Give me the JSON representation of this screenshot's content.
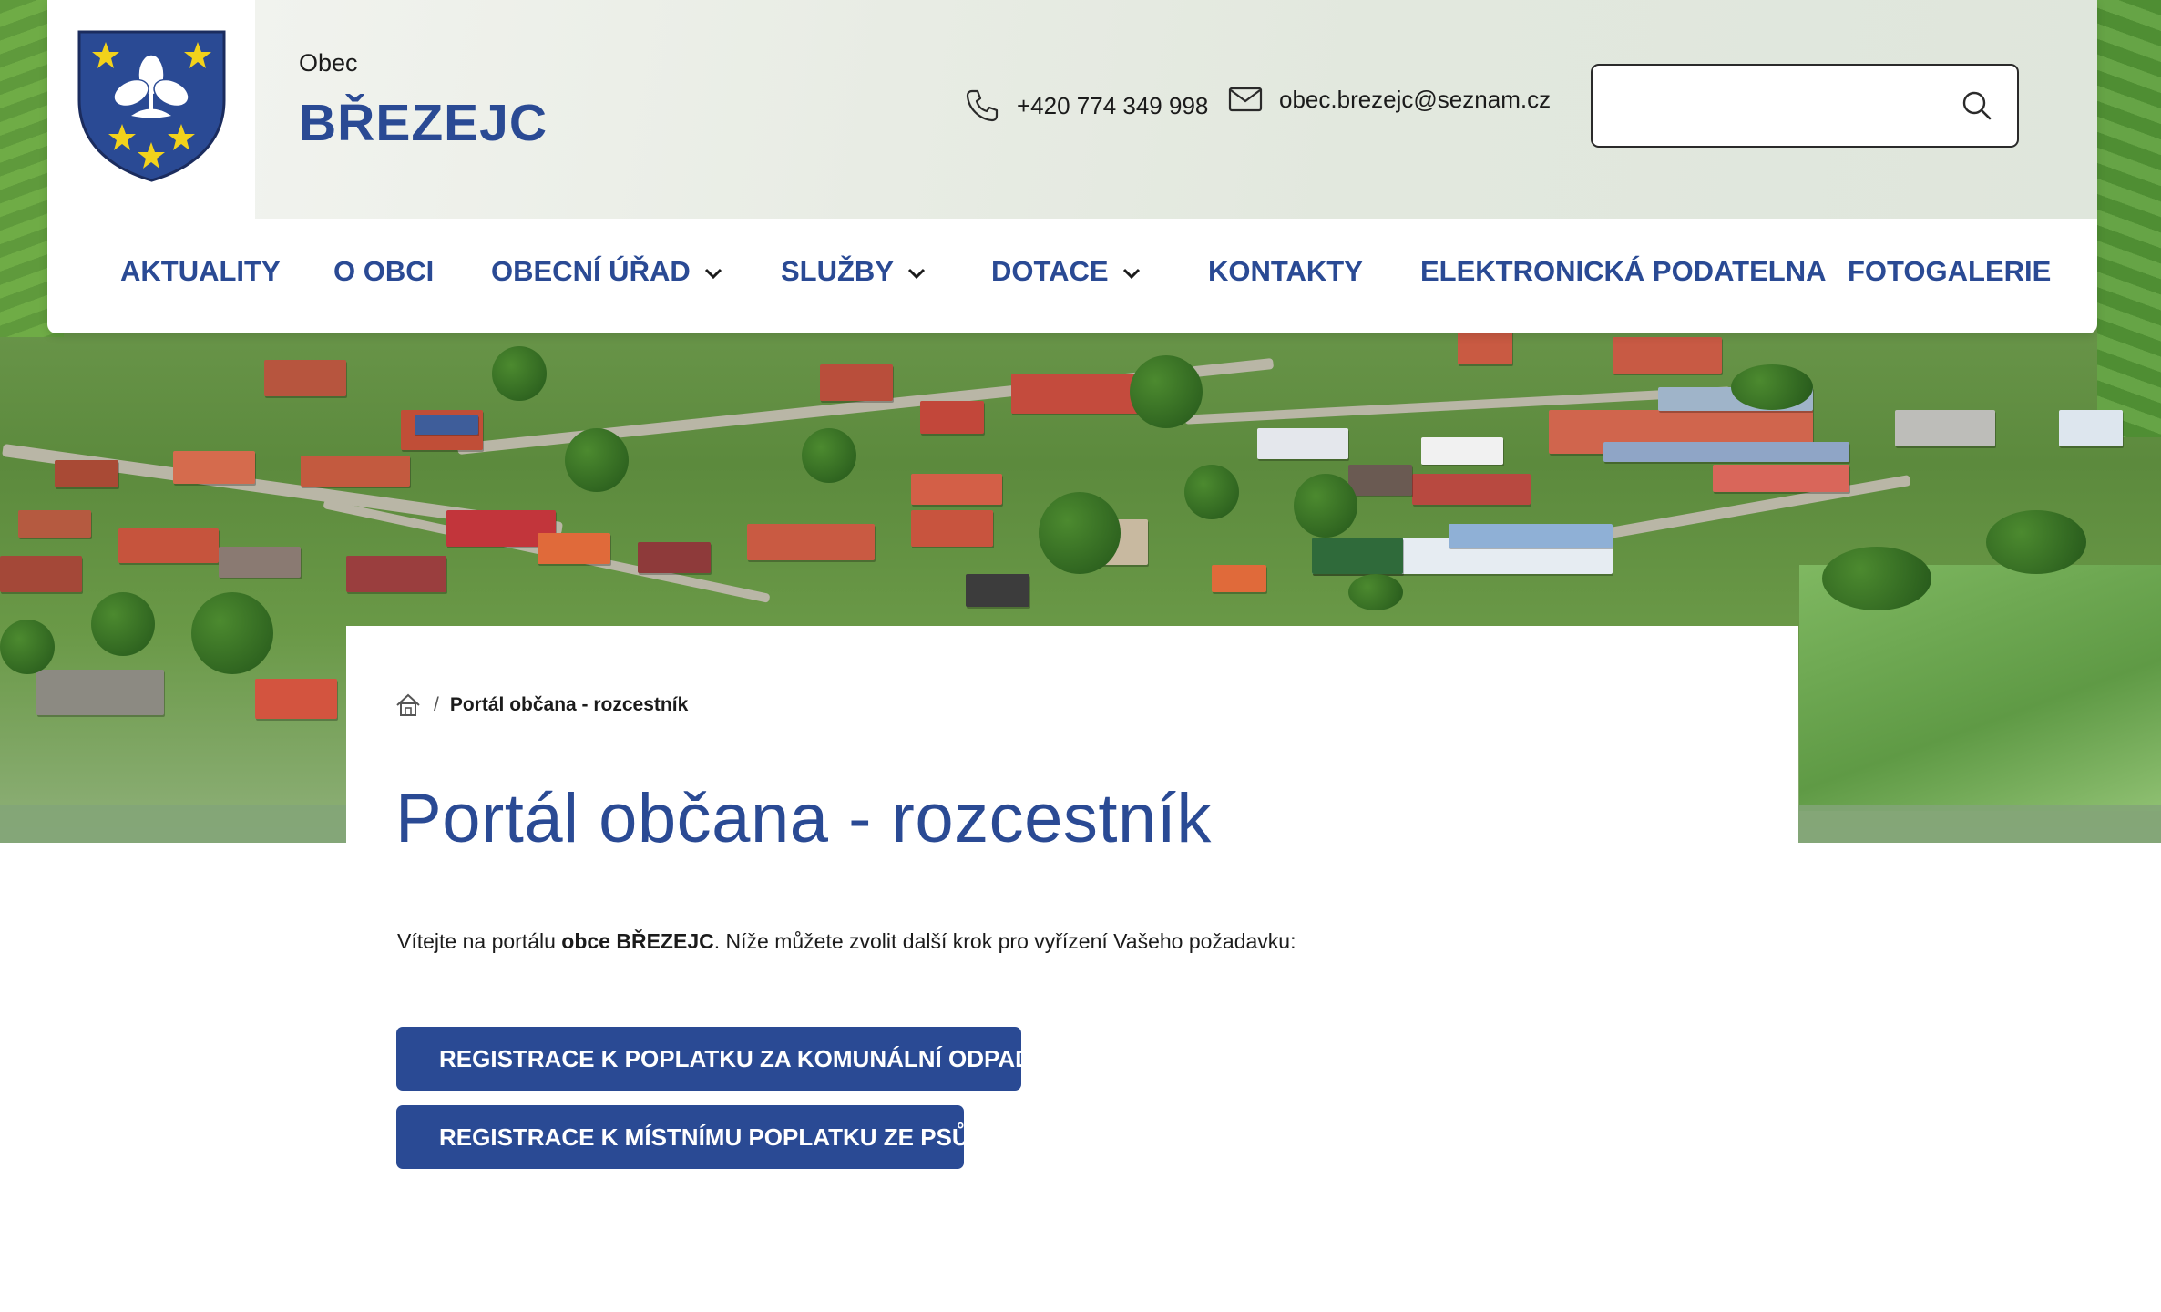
{
  "header": {
    "brand_small": "Obec",
    "brand_name": "BŘEZEJC",
    "phone": "+420 774 349 998",
    "email": "obec.brezejc@seznam.cz",
    "search_placeholder": ""
  },
  "nav": {
    "items": [
      {
        "label": "AKTUALITY",
        "has_dropdown": false
      },
      {
        "label": "O OBCI",
        "has_dropdown": false
      },
      {
        "label": "OBECNÍ ÚŘAD",
        "has_dropdown": true
      },
      {
        "label": "SLUŽBY",
        "has_dropdown": true
      },
      {
        "label": "DOTACE",
        "has_dropdown": true
      },
      {
        "label": "KONTAKTY",
        "has_dropdown": false
      },
      {
        "label": "ELEKTRONICKÁ PODATELNA",
        "has_dropdown": false
      },
      {
        "label": "FOTOGALERIE",
        "has_dropdown": false
      }
    ]
  },
  "breadcrumb": {
    "separator": "/",
    "current": "Portál občana - rozcestník"
  },
  "main": {
    "title": "Portál občana - rozcestník",
    "intro_before": "Vítejte na portálu ",
    "intro_bold": "obce BŘEZEJC",
    "intro_after": ". Níže můžete zvolit další krok pro vyřízení Vašeho požadavku:",
    "buttons": [
      {
        "label": "REGISTRACE K POPLATKU ZA KOMUNÁLNÍ ODPAD"
      },
      {
        "label": "REGISTRACE K MÍSTNÍMU POPLATKU ZE PSŮ"
      }
    ]
  },
  "colors": {
    "primary": "#2a4a94",
    "text": "#1b1b1b",
    "background": "#ffffff",
    "crest_blue": "#2a4a94",
    "crest_star": "#f2d21b"
  },
  "icons": {
    "phone": "phone-icon",
    "email": "mail-icon",
    "search": "search-icon",
    "home": "home-icon",
    "dropdown": "chevron-down-icon"
  }
}
